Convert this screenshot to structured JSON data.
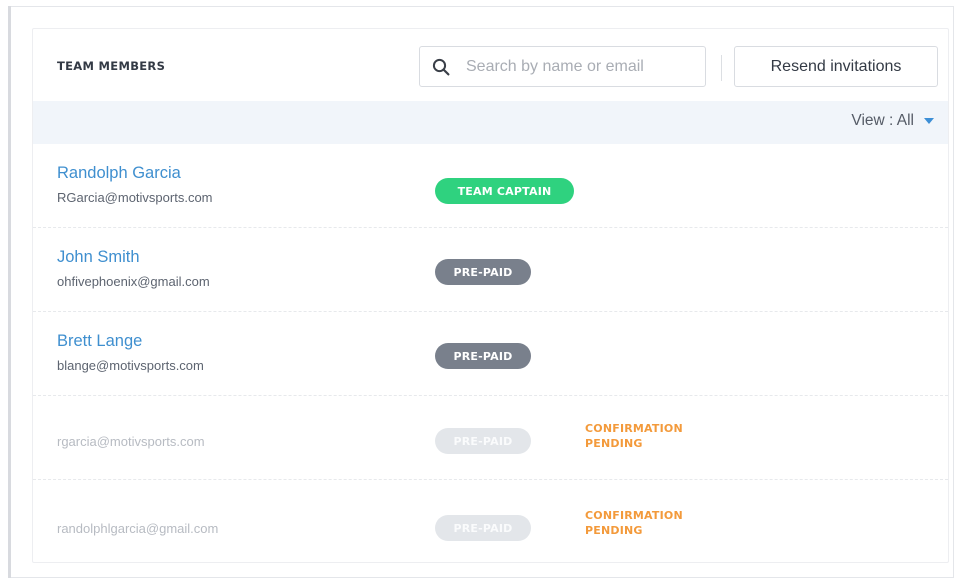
{
  "header": {
    "title": "TEAM MEMBERS",
    "search_placeholder": "Search by name or email",
    "resend_label": "Resend invitations"
  },
  "view": {
    "label": "View : All"
  },
  "colors": {
    "link": "#3f8fcf",
    "captain": "#2fd27f",
    "prepaid": "#79808c",
    "pending": "#f39a3b"
  },
  "members": [
    {
      "name": "Randolph Garcia",
      "email": "RGarcia@motivsports.com",
      "badge": "TEAM CAPTAIN"
    },
    {
      "name": "John Smith",
      "email": "ohfivephoenix@gmail.com",
      "badge": "PRE-PAID"
    },
    {
      "name": "Brett Lange",
      "email": "blange@motivsports.com",
      "badge": "PRE-PAID"
    },
    {
      "email": "rgarcia@motivsports.com",
      "badge": "PRE-PAID",
      "status_line1": "CONFIRMATION",
      "status_line2": "PENDING"
    },
    {
      "email": "randolphlgarcia@gmail.com",
      "badge": "PRE-PAID",
      "status_line1": "CONFIRMATION",
      "status_line2": "PENDING"
    }
  ]
}
